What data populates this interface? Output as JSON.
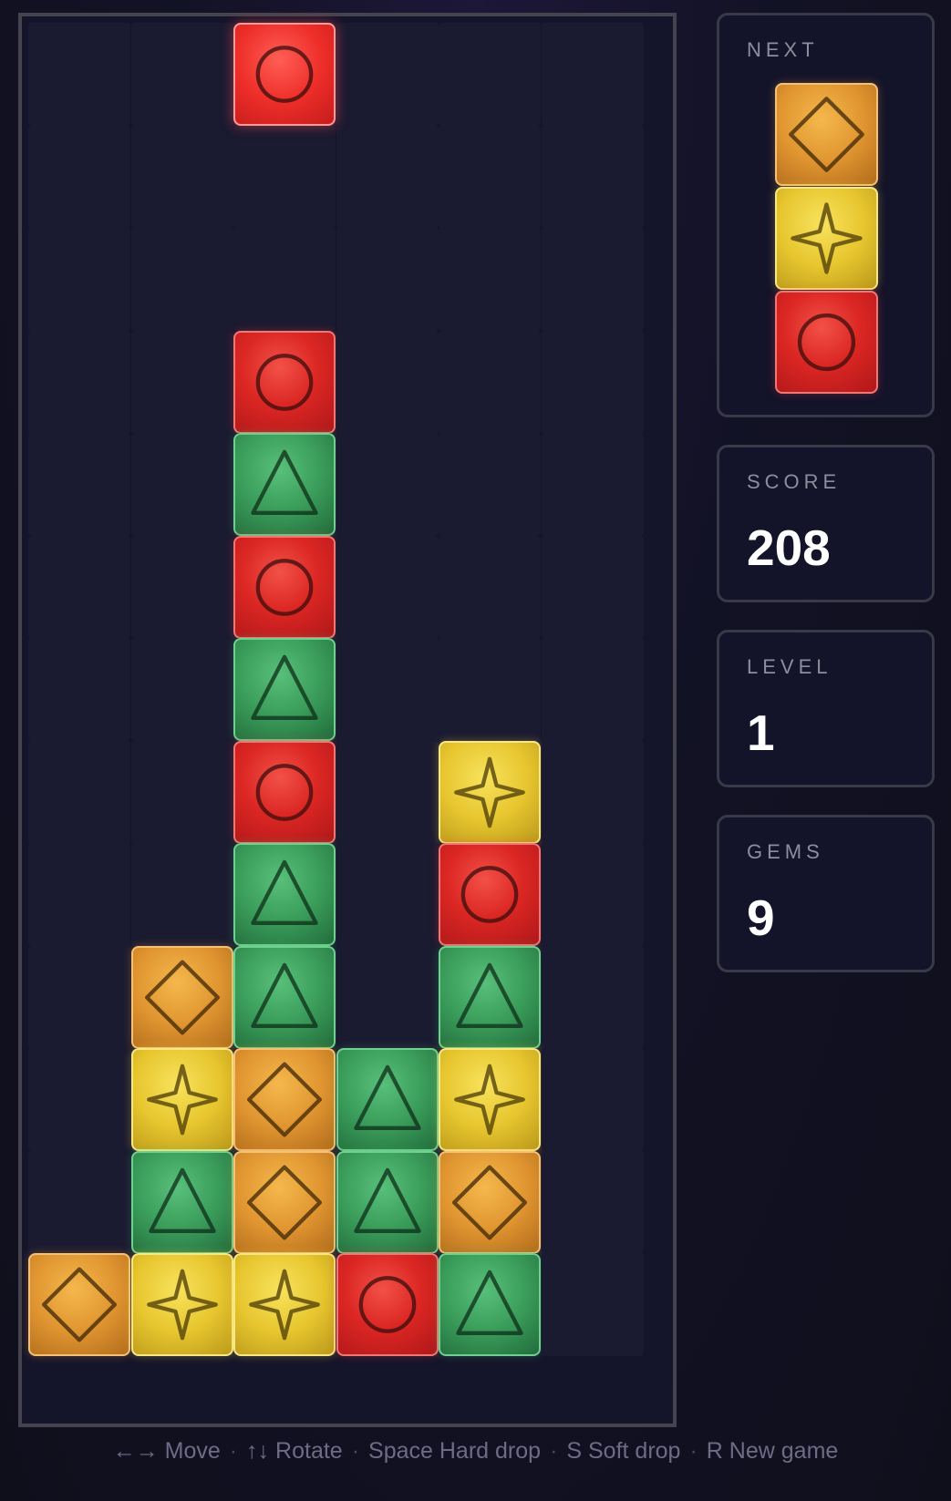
{
  "board": {
    "cols": 6,
    "rows": 13,
    "active_piece": {
      "col": 2,
      "row": 0,
      "gem": "red"
    },
    "locked": [
      [
        "",
        "",
        "",
        "",
        "",
        ""
      ],
      [
        "",
        "",
        "",
        "",
        "",
        ""
      ],
      [
        "",
        "",
        "",
        "",
        "",
        ""
      ],
      [
        "",
        "",
        "red",
        "",
        "",
        ""
      ],
      [
        "",
        "",
        "green",
        "",
        "",
        ""
      ],
      [
        "",
        "",
        "red",
        "",
        "",
        ""
      ],
      [
        "",
        "",
        "green",
        "",
        "",
        ""
      ],
      [
        "",
        "",
        "red",
        "",
        "yellow",
        ""
      ],
      [
        "",
        "",
        "green",
        "",
        "red",
        ""
      ],
      [
        "",
        "orange",
        "green",
        "",
        "green",
        ""
      ],
      [
        "",
        "yellow",
        "orange",
        "green",
        "yellow",
        ""
      ],
      [
        "",
        "green",
        "orange",
        "green",
        "orange",
        ""
      ],
      [
        "orange",
        "yellow",
        "yellow",
        "red",
        "green",
        ""
      ]
    ]
  },
  "gem_types": {
    "red": {
      "icon": "circle-icon",
      "color": "#dc2723"
    },
    "green": {
      "icon": "triangle-icon",
      "color": "#3a9c5a"
    },
    "yellow": {
      "icon": "star-icon",
      "color": "#e7c62f"
    },
    "orange": {
      "icon": "diamond-icon",
      "color": "#e09530"
    }
  },
  "sidebar": {
    "next": {
      "label": "NEXT",
      "pieces": [
        "orange",
        "yellow",
        "red"
      ]
    },
    "score": {
      "label": "SCORE",
      "value": "208"
    },
    "level": {
      "label": "LEVEL",
      "value": "1"
    },
    "gems": {
      "label": "GEMS",
      "value": "9"
    }
  },
  "help": {
    "move": "←→ Move",
    "rotate": "↑↓ Rotate",
    "hard_drop": "Space Hard drop",
    "soft_drop": "S Soft drop",
    "new_game": "R New game",
    "separator": "·"
  }
}
